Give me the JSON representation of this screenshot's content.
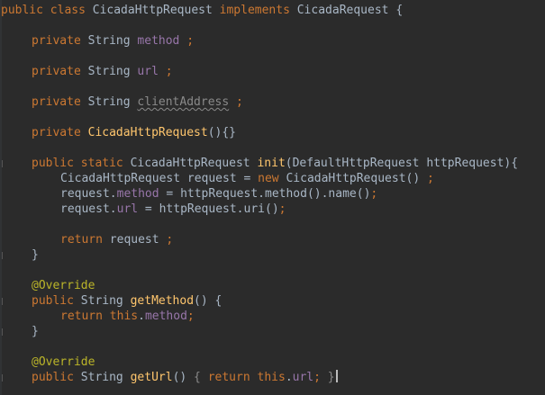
{
  "code": {
    "l1": {
      "kw1": "public class ",
      "cls": "CicadaHttpRequest ",
      "kw2": "implements ",
      "iface": "CicadaRequest ",
      "brace": "{"
    },
    "l2": {
      "kw": "private ",
      "type": "String ",
      "field": "method ",
      "semi": ";"
    },
    "l3": {
      "kw": "private ",
      "type": "String ",
      "field": "url ",
      "semi": ";"
    },
    "l4": {
      "kw": "private ",
      "type": "String ",
      "field": "clientAddress",
      "sp": " ",
      "semi": ";"
    },
    "l5": {
      "kw": "private ",
      "name": "CicadaHttpRequest",
      "rest": "(){}"
    },
    "l6": {
      "kw": "public static ",
      "type": "CicadaHttpRequest ",
      "name": "init",
      "rest": "(DefaultHttpRequest httpRequest){"
    },
    "l7": {
      "a": "CicadaHttpRequest request = ",
      "kw": "new ",
      "b": "CicadaHttpRequest() ",
      "semi": ";"
    },
    "l8": {
      "a": "request.",
      "field": "method",
      "b": " = httpRequest.method().name()",
      "semi": ";"
    },
    "l9": {
      "a": "request.",
      "field": "url",
      "b": " = httpRequest.uri()",
      "semi": ";"
    },
    "l10": {
      "kw": "return ",
      "a": "request ",
      "semi": ";"
    },
    "l11": {
      "brace": "}"
    },
    "l12": {
      "ann": "@Override"
    },
    "l13": {
      "kw": "public ",
      "type": "String ",
      "name": "getMethod",
      "rest": "() {"
    },
    "l14": {
      "kw": "return ",
      "kw2": "this",
      "dot": ".",
      "field": "method",
      "semi": ";"
    },
    "l15": {
      "brace": "}"
    },
    "l16": {
      "ann": "@Override"
    },
    "l17": {
      "kw": "public ",
      "type": "String ",
      "name": "getUrl",
      "rest": "() ",
      "ob": "{ ",
      "kw2": "return ",
      "kw3": "this",
      "dot": ".",
      "field": "url",
      "semi": ";",
      "sp": " ",
      "cb": "}"
    }
  },
  "colors": {
    "background": "#2b2b2b",
    "keyword": "#cc7832",
    "field": "#9876aa",
    "method": "#ffc66d",
    "annotation": "#bbb529",
    "text": "#a9b7c6"
  }
}
